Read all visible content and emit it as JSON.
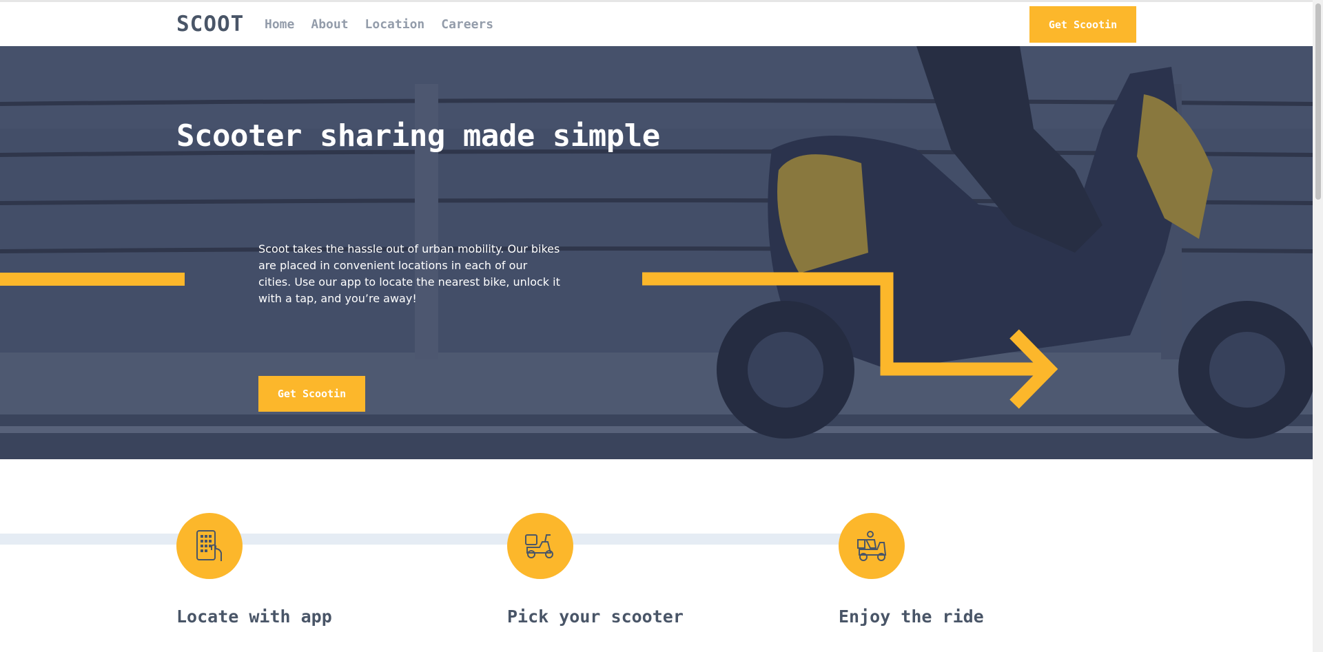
{
  "brand": {
    "logo": "SCOOT"
  },
  "nav": {
    "items": [
      "Home",
      "About",
      "Location",
      "Careers"
    ]
  },
  "header": {
    "cta_label": "Get Scootin"
  },
  "hero": {
    "title": "Scooter sharing made simple",
    "text": "Scoot takes the hassle out of urban mobility. Our bikes are placed in convenient locations in each of our cities. Use our app to locate the nearest bike, unlock it with a tap, and you’re away!",
    "cta_label": "Get Scootin"
  },
  "steps": [
    {
      "title": "Locate with app",
      "icon": "phone-app-icon"
    },
    {
      "title": "Pick your scooter",
      "icon": "scooter-icon"
    },
    {
      "title": "Enjoy the ride",
      "icon": "rider-icon"
    }
  ],
  "colors": {
    "accent": "#fcb72b",
    "dark": "#495567",
    "muted": "#939caa",
    "line": "#e5ecf4"
  }
}
